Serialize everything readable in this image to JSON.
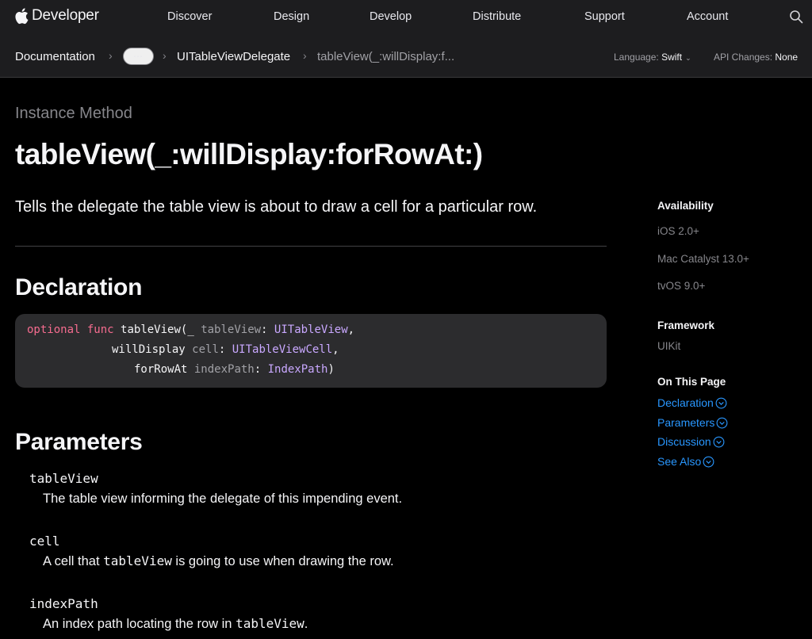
{
  "globalnav": {
    "brand": "Developer",
    "items": [
      "Discover",
      "Design",
      "Develop",
      "Distribute",
      "Support",
      "Account"
    ]
  },
  "localnav": {
    "breadcrumbs": [
      "Documentation",
      "UITableViewDelegate",
      "tableView(_:willDisplay:f..."
    ],
    "ellipsis": "⋯",
    "language_label": "Language:",
    "language_value": "Swift",
    "api_label": "API Changes:",
    "api_value": "None"
  },
  "main": {
    "eyebrow": "Instance Method",
    "title": "tableView(_:willDisplay:forRowAt:)",
    "abstract": "Tells the delegate the table view is about to draw a cell for a particular row.",
    "declaration_heading": "Declaration",
    "code": {
      "l1_kw1": "optional",
      "l1_kw2": "func",
      "l1_name": "tableView(_",
      "l1_param": "tableView",
      "l1_type": "UITableView",
      "l2_label": "willDisplay",
      "l2_param": "cell",
      "l2_type": "UITableViewCell",
      "l3_label": "forRowAt",
      "l3_param": "indexPath",
      "l3_type": "IndexPath"
    },
    "parameters_heading": "Parameters",
    "parameters": [
      {
        "name": "tableView",
        "desc": "The table view informing the delegate of this impending event."
      },
      {
        "name": "cell",
        "desc_pre": "A cell that ",
        "desc_code": "tableView",
        "desc_post": " is going to use when drawing the row."
      },
      {
        "name": "indexPath",
        "desc_pre": "An index path locating the row in ",
        "desc_code": "tableView",
        "desc_post": "."
      }
    ]
  },
  "sidebar": {
    "availability_heading": "Availability",
    "availability": [
      "iOS 2.0+",
      "Mac Catalyst 13.0+",
      "tvOS 9.0+"
    ],
    "framework_heading": "Framework",
    "framework": "UIKit",
    "on_this_page_heading": "On This Page",
    "on_this_page": [
      "Declaration",
      "Parameters",
      "Discussion",
      "See Also"
    ]
  },
  "colors": {
    "link": "#2997ff",
    "keyword": "#f56c8f",
    "type": "#c9a8ff",
    "background": "#000000",
    "nav": "#1d1d1f",
    "code_bg": "#2c2c2e"
  }
}
